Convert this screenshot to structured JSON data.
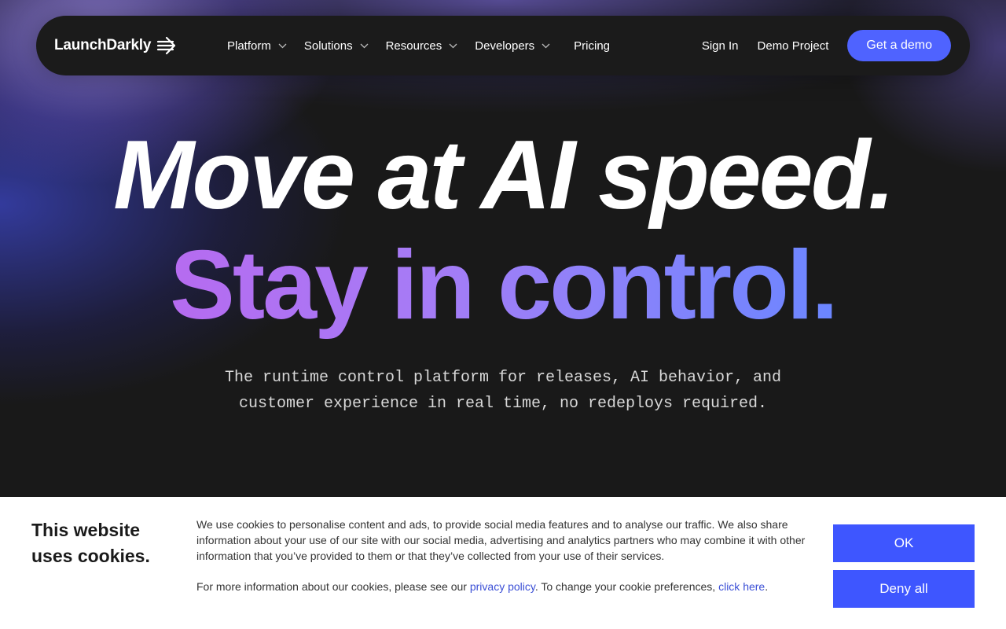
{
  "nav": {
    "logo_text": "LaunchDarkly",
    "items": [
      {
        "label": "Platform",
        "has_dropdown": true
      },
      {
        "label": "Solutions",
        "has_dropdown": true
      },
      {
        "label": "Resources",
        "has_dropdown": true
      },
      {
        "label": "Developers",
        "has_dropdown": true
      },
      {
        "label": "Pricing",
        "has_dropdown": false
      }
    ],
    "sign_in": "Sign In",
    "demo_project": "Demo Project",
    "cta": "Get a demo"
  },
  "hero": {
    "headline_1": "Move at AI speed.",
    "headline_2": "Stay in control.",
    "subtitle_line_1": "The runtime control platform for releases, AI behavior, and",
    "subtitle_line_2": "customer experience in real time, no redeploys required."
  },
  "cookie_banner": {
    "title_line_1": "This website",
    "title_line_2": "uses cookies.",
    "body": "We use cookies to personalise content and ads, to provide social media features and to analyse our traffic. We also share information about your use of our site with our social media, advertising and analytics partners who may combine it with other information that you’ve provided to them or that they’ve collected from your use of their services.",
    "more_prefix": "For more information about our cookies, please see our ",
    "privacy_link": "privacy policy",
    "more_middle": ". To change your cookie preferences, ",
    "click_link": "click here",
    "more_suffix": ".",
    "ok_label": "OK",
    "deny_label": "Deny all"
  },
  "colors": {
    "accent": "#4f63ff",
    "cookie_button": "#3e56ff",
    "link": "#3b4fd6",
    "gradient_start": "#b66bf0",
    "gradient_end": "#6b86ff",
    "background": "#191919"
  },
  "icons": {
    "logo": "arrow-right-icon",
    "dropdown": "chevron-down-icon"
  }
}
